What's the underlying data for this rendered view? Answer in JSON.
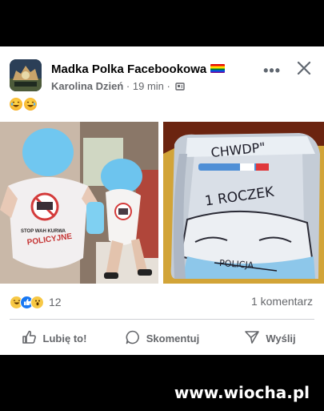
{
  "post": {
    "group_name": "Madka Polka Facebookowa",
    "author": "Karolina Dzień",
    "time": "19 min",
    "separator": "·",
    "more_icon": "more-options-icon",
    "close_icon": "close-icon"
  },
  "photos": {
    "left_onesie_text": "STOP WAH KURWA POLICYJNE",
    "cake_text_top": "CHWDP\"",
    "cake_text_mid": "1 ROCZEK",
    "cake_text_bottom": "POLICJA"
  },
  "stats": {
    "reactions_count": "12",
    "comments": "1 komentarz"
  },
  "actions": {
    "like": "Lubię to!",
    "comment": "Skomentuj",
    "share": "Wyślij"
  },
  "watermark": "www.wiocha.pl",
  "colors": {
    "like_blue": "#1877f2",
    "text_secondary": "#65676b",
    "divider": "#ced0d4"
  }
}
